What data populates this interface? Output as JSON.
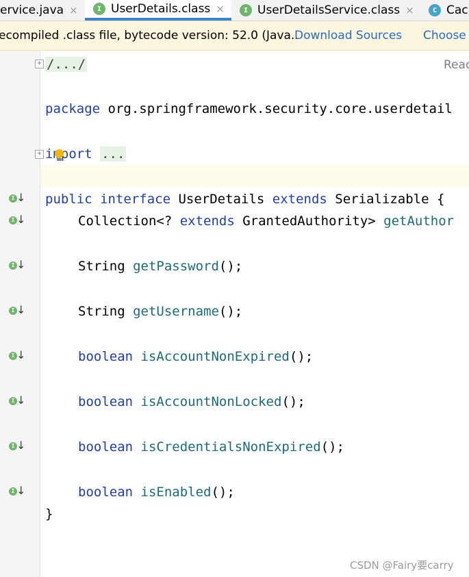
{
  "tabs": [
    {
      "label": "ervice.java",
      "icon": "none",
      "active": false
    },
    {
      "label": "UserDetails.class",
      "icon": "interface-icon",
      "badge": "I",
      "active": true
    },
    {
      "label": "UserDetailsService.class",
      "icon": "interface-icon",
      "badge": "I",
      "active": false
    },
    {
      "label": "Cac",
      "icon": "class-icon",
      "badge": "C",
      "active": false
    }
  ],
  "close_glyph": "×",
  "banner": {
    "message": "ecompiled .class file, bytecode version: 52.0 (Java..",
    "download_link": "Download Sources",
    "choose_link": "Choose"
  },
  "reader_mode": "Reac",
  "code": {
    "folded_header": "/.../",
    "package_kw": "package",
    "package_name": " org.springframework.security.core.userdetail",
    "import_kw": "import",
    "import_folded": "...",
    "decl": {
      "kw1": "public",
      "kw2": "interface",
      "name": " UserDetails ",
      "kw3": "extends",
      "rest": " Serializable {"
    },
    "methods": [
      {
        "type": "Collection<? ",
        "type_kw": "extends",
        "type_rest": " GrantedAuthority> ",
        "name": "getAuthor",
        "suffix": ""
      },
      {
        "type": "String ",
        "name": "getPassword",
        "suffix": "();"
      },
      {
        "type": "String ",
        "name": "getUsername",
        "suffix": "();"
      },
      {
        "type_kwonly": "boolean",
        "name": "isAccountNonExpired",
        "suffix": "();"
      },
      {
        "type_kwonly": "boolean",
        "name": "isAccountNonLocked",
        "suffix": "();"
      },
      {
        "type_kwonly": "boolean",
        "name": "isCredentialsNonExpired",
        "suffix": "();"
      },
      {
        "type_kwonly": "boolean",
        "name": "isEnabled",
        "suffix": "();"
      }
    ],
    "closing_brace": "}"
  },
  "gutter_badge": "I",
  "watermark": "CSDN @Fairy要carry",
  "colors": {
    "keyword": "#1f3fa3",
    "method": "#1b6a7b",
    "link": "#2a6bbf",
    "interface_badge": "#6fb56c",
    "class_badge": "#47a4c7",
    "active_tab_underline": "#4083c9"
  }
}
